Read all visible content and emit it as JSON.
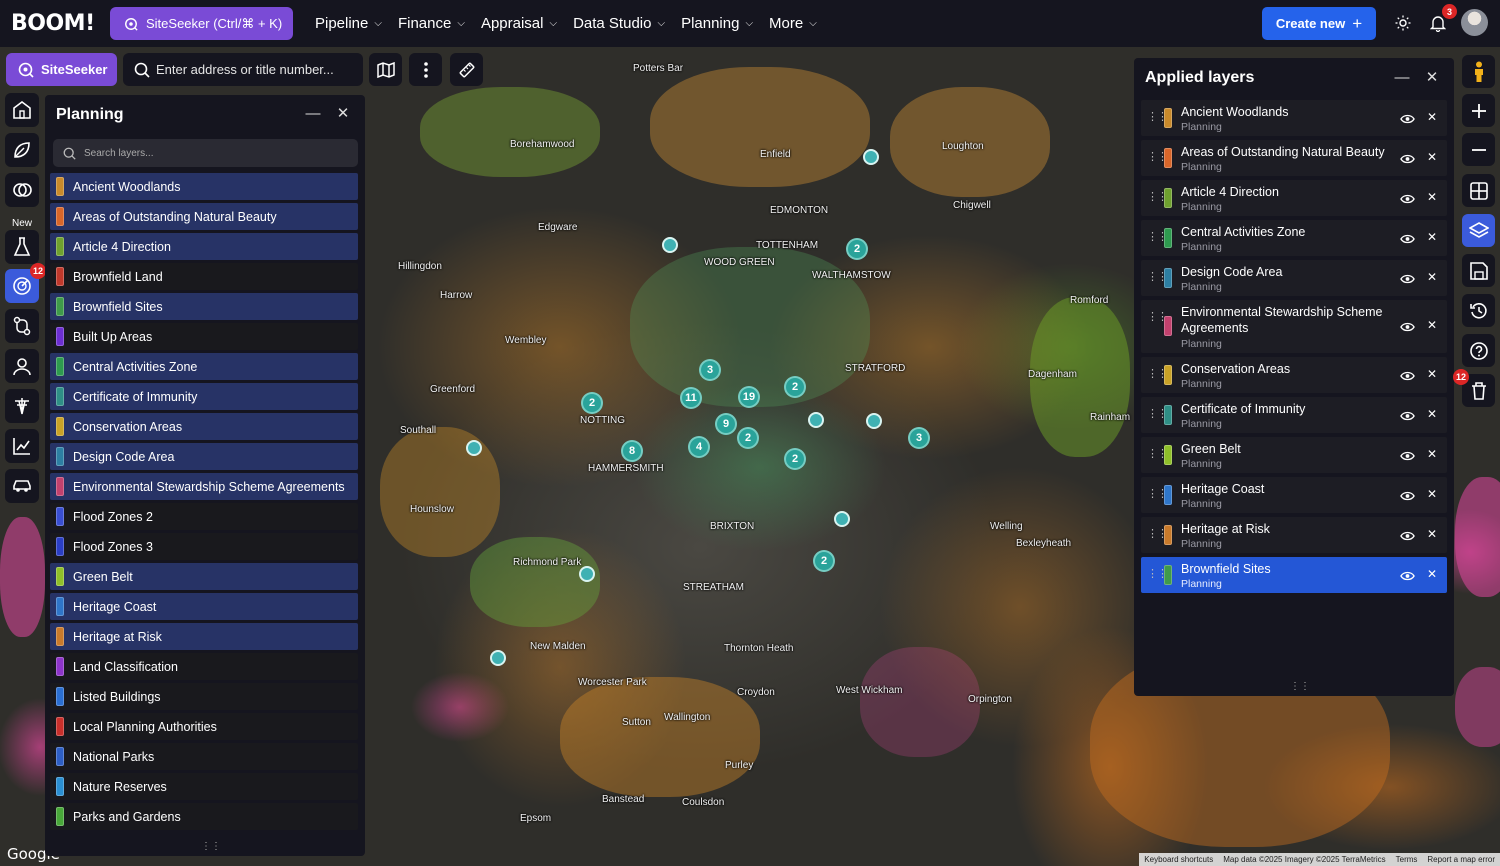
{
  "header": {
    "logo": "BOOM!",
    "siteseeker_label": "SiteSeeker (Ctrl/⌘ + K)",
    "nav": [
      {
        "label": "Pipeline"
      },
      {
        "label": "Finance"
      },
      {
        "label": "Appraisal"
      },
      {
        "label": "Data Studio"
      },
      {
        "label": "Planning"
      },
      {
        "label": "More"
      }
    ],
    "create_new": "Create new",
    "notification_count": "3"
  },
  "toolbar": {
    "siteseeker_chip": "SiteSeeker",
    "address_placeholder": "Enter address or title number..."
  },
  "rail": {
    "new_label": "New",
    "badge": "12"
  },
  "planning_panel": {
    "title": "Planning",
    "search_placeholder": "Search layers...",
    "layers": [
      {
        "name": "Ancient Woodlands",
        "color": "#c98a2b",
        "on": true
      },
      {
        "name": "Areas of Outstanding Natural Beauty",
        "color": "#d9662a",
        "on": true
      },
      {
        "name": "Article 4 Direction",
        "color": "#6fa12f",
        "on": true
      },
      {
        "name": "Brownfield Land",
        "color": "#c0392b",
        "on": false
      },
      {
        "name": "Brownfield Sites",
        "color": "#3f9a4a",
        "on": true
      },
      {
        "name": "Built Up Areas",
        "color": "#6d2fd0",
        "on": false
      },
      {
        "name": "Central Activities Zone",
        "color": "#2e9a4f",
        "on": true
      },
      {
        "name": "Certificate of Immunity",
        "color": "#2f8f86",
        "on": true
      },
      {
        "name": "Conservation Areas",
        "color": "#c9a227",
        "on": true
      },
      {
        "name": "Design Code Area",
        "color": "#2d7fa3",
        "on": true
      },
      {
        "name": "Environmental Stewardship Scheme Agreements",
        "color": "#c2416e",
        "on": true
      },
      {
        "name": "Flood Zones 2",
        "color": "#3a4fd0",
        "on": false
      },
      {
        "name": "Flood Zones 3",
        "color": "#2b3fc4",
        "on": false
      },
      {
        "name": "Green Belt",
        "color": "#8fbf2a",
        "on": true
      },
      {
        "name": "Heritage Coast",
        "color": "#2f76c9",
        "on": true
      },
      {
        "name": "Heritage at Risk",
        "color": "#c97a2b",
        "on": true
      },
      {
        "name": "Land Classification",
        "color": "#8e35c9",
        "on": false
      },
      {
        "name": "Listed Buildings",
        "color": "#2b6fd1",
        "on": false
      },
      {
        "name": "Local Planning Authorities",
        "color": "#c9302b",
        "on": false
      },
      {
        "name": "National Parks",
        "color": "#2e5fc4",
        "on": false
      },
      {
        "name": "Nature Reserves",
        "color": "#2b8fd1",
        "on": false
      },
      {
        "name": "Parks and Gardens",
        "color": "#49a83a",
        "on": false
      }
    ]
  },
  "applied_panel": {
    "title": "Applied layers",
    "layers": [
      {
        "name": "Ancient Woodlands",
        "sub": "Planning",
        "color": "#c98a2b",
        "tall": false,
        "selected": false
      },
      {
        "name": "Areas of Outstanding Natural Beauty",
        "sub": "Planning",
        "color": "#d9662a",
        "tall": false,
        "selected": false
      },
      {
        "name": "Article 4 Direction",
        "sub": "Planning",
        "color": "#6fa12f",
        "tall": false,
        "selected": false
      },
      {
        "name": "Central Activities Zone",
        "sub": "Planning",
        "color": "#2e9a4f",
        "tall": false,
        "selected": false
      },
      {
        "name": "Design Code Area",
        "sub": "Planning",
        "color": "#2d7fa3",
        "tall": false,
        "selected": false
      },
      {
        "name": "Environmental Stewardship Scheme Agreements",
        "sub": "Planning",
        "color": "#c2416e",
        "tall": true,
        "selected": false
      },
      {
        "name": "Conservation Areas",
        "sub": "Planning",
        "color": "#c9a227",
        "tall": false,
        "selected": false
      },
      {
        "name": "Certificate of Immunity",
        "sub": "Planning",
        "color": "#2f8f86",
        "tall": false,
        "selected": false
      },
      {
        "name": "Green Belt",
        "sub": "Planning",
        "color": "#8fbf2a",
        "tall": false,
        "selected": false
      },
      {
        "name": "Heritage Coast",
        "sub": "Planning",
        "color": "#2f76c9",
        "tall": false,
        "selected": false
      },
      {
        "name": "Heritage at Risk",
        "sub": "Planning",
        "color": "#c97a2b",
        "tall": false,
        "selected": false
      },
      {
        "name": "Brownfield Sites",
        "sub": "Planning",
        "color": "#3f9a4a",
        "tall": false,
        "selected": true
      }
    ]
  },
  "map": {
    "places": [
      "Potters Bar",
      "Enfield",
      "EDMONTON",
      "TOTTENHAM",
      "WOOD GREEN",
      "WALTHAMSTOW",
      "Romford",
      "Harrow",
      "Wembley",
      "STRATFORD",
      "NOTTING",
      "HAMMERSMITH",
      "BRIXTON",
      "Richmond Park",
      "STREATHAM",
      "Thornton Heath",
      "Croydon",
      "West Wickham",
      "Orpington",
      "Welling",
      "Bexleyheath",
      "Hounslow",
      "New Malden",
      "Worcester Park",
      "Sutton",
      "Wallington",
      "Purley",
      "Coulsdon",
      "Banstead",
      "Epsom",
      "Dagenham",
      "Rainham",
      "Chigwell",
      "Loughton",
      "Borehamwood",
      "Edgware",
      "Hillingdon",
      "Southall",
      "Greenford"
    ],
    "clusters": [
      "2",
      "3",
      "11",
      "19",
      "2",
      "9",
      "2",
      "8",
      "4",
      "2",
      "3",
      "2",
      "2"
    ],
    "google": "Google",
    "attribution": [
      "Keyboard shortcuts",
      "Map data ©2025 Imagery ©2025 TerraMetrics",
      "Terms",
      "Report a map error"
    ]
  },
  "map_controls": {
    "badge": "12"
  }
}
